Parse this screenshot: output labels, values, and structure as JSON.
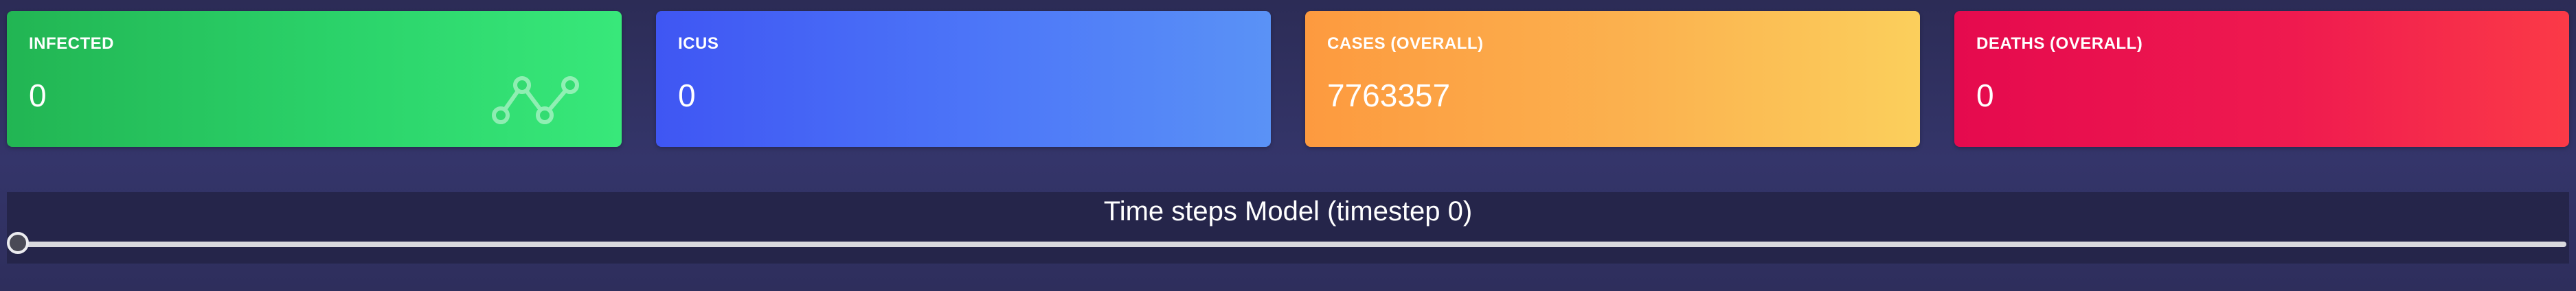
{
  "cards": [
    {
      "label": "INFECTED",
      "value": "0",
      "icon": "line-chart-icon",
      "color": "#2bd36a"
    },
    {
      "label": "ICUS",
      "value": "0",
      "color": "#4d77f8"
    },
    {
      "label": "CASES (OVERALL)",
      "value": "7763357",
      "color": "#fbb24f"
    },
    {
      "label": "DEATHS (OVERALL)",
      "value": "0",
      "color": "#ef1a4f"
    }
  ],
  "timestep": {
    "title": "Time steps Model (timestep 0)",
    "current": 0
  }
}
